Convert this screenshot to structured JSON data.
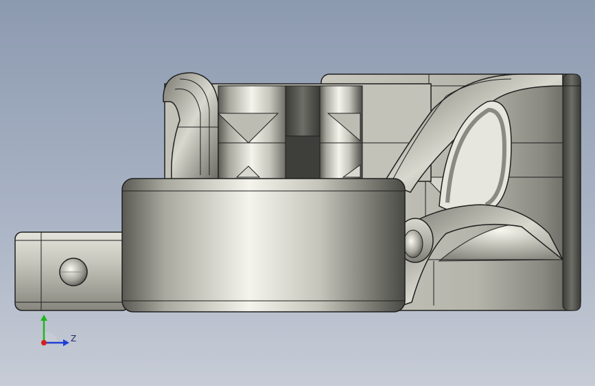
{
  "viewport": {
    "background_top": "#8c9ab0",
    "background_bottom": "#c7ccd6"
  },
  "model": {
    "body_color": "#b9b9ae",
    "edge_color": "#1e1e1e"
  },
  "triad": {
    "z_label": "Z",
    "y_axis_color": "#1fb51f",
    "z_axis_color": "#1f3fd6",
    "origin_color": "#d61f1f",
    "icons": [
      "y-axis-arrow-icon",
      "z-axis-arrow-icon",
      "origin-dot-icon"
    ]
  }
}
